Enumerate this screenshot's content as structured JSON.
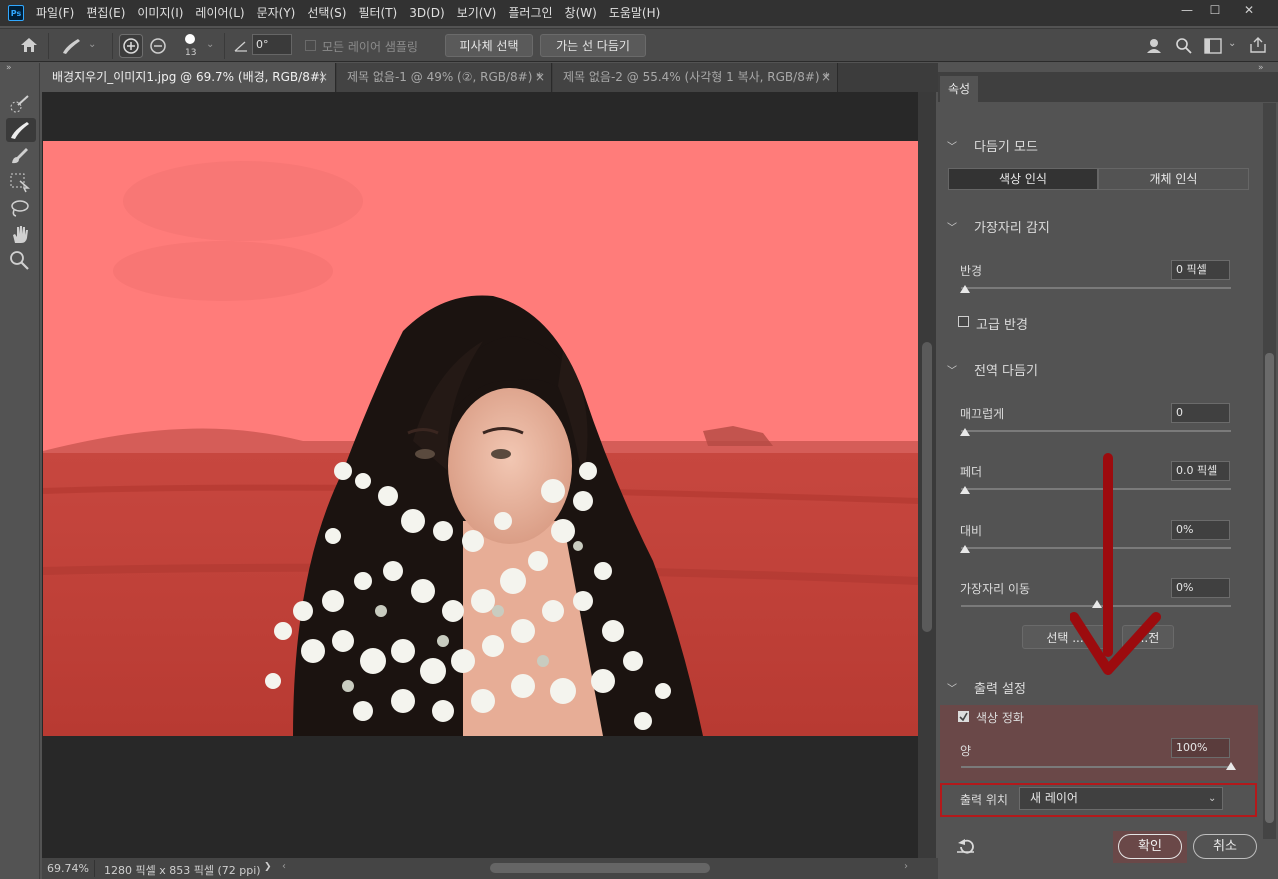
{
  "app": {
    "logo_text": "Ps"
  },
  "menu": [
    "파일(F)",
    "편집(E)",
    "이미지(I)",
    "레이어(L)",
    "문자(Y)",
    "선택(S)",
    "필터(T)",
    "3D(D)",
    "보기(V)",
    "플러그인",
    "창(W)",
    "도움말(H)"
  ],
  "window_controls": {
    "minimize": "—",
    "maximize": "☐",
    "close": "✕"
  },
  "options": {
    "brush_size": "13",
    "angle_value": "0°",
    "sample_all_layers": "모든 레이어 샘플링",
    "select_subject": "피사체 선택",
    "refine_hair": "가는 선 다듬기"
  },
  "tabs": [
    {
      "label": "배경지우기_이미지1.jpg @ 69.7% (배경, RGB/8#)",
      "close": "×"
    },
    {
      "label": "제목 없음-1 @ 49% (②, RGB/8#) *",
      "close": "×"
    },
    {
      "label": "제목 없음-2 @ 55.4% (사각형 1 복사, RGB/8#) *",
      "close": "×"
    }
  ],
  "status": {
    "zoom": "69.74%",
    "doc_info": "1280 픽셀 x 853 픽셀 (72 ppi)",
    "arrow": "❯"
  },
  "panel": {
    "tab": "속성",
    "refine_mode": {
      "title": "다듬기 모드",
      "opt1": "색상 인식",
      "opt2": "개체 인식"
    },
    "edge_detection": {
      "title": "가장자리 감지",
      "radius_label": "반경",
      "radius_value": "0 픽셀",
      "smart_radius": "고급 반경"
    },
    "global_refine": {
      "title": "전역 다듬기",
      "smooth_label": "매끄럽게",
      "smooth_value": "0",
      "feather_label": "페더",
      "feather_value": "0.0 픽셀",
      "contrast_label": "대비",
      "contrast_value": "0%",
      "shift_label": "가장자리 이동",
      "shift_value": "0%",
      "clear_btn": "선택 ...",
      "invert_btn": "...전"
    },
    "output": {
      "title": "출력 설정",
      "decontaminate": "색상 정화",
      "amount_label": "양",
      "amount_value": "100%",
      "output_to_label": "출력 위치",
      "output_to_value": "새 레이어"
    },
    "ok": "확인",
    "cancel": "취소"
  }
}
